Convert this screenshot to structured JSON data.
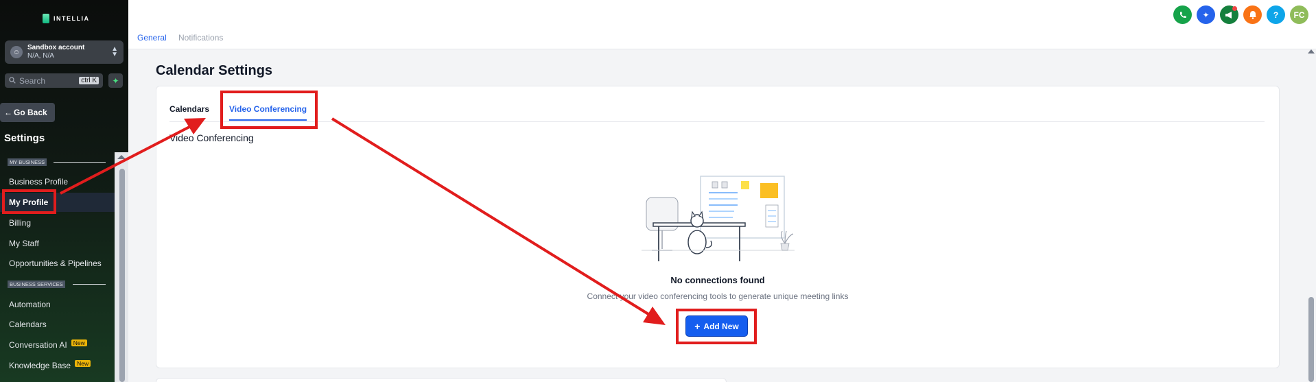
{
  "sidebar": {
    "logo_text": "INTELLIA",
    "account": {
      "name": "Sandbox account",
      "sub": "N/A, N/A"
    },
    "search": {
      "placeholder": "Search",
      "shortcut": "ctrl K"
    },
    "go_back": "Go Back",
    "settings_title": "Settings",
    "sections": [
      {
        "label": "MY BUSINESS"
      },
      {
        "label": "BUSINESS SERVICES"
      }
    ],
    "items": [
      {
        "label": "Business Profile"
      },
      {
        "label": "My Profile",
        "active": true
      },
      {
        "label": "Billing"
      },
      {
        "label": "My Staff"
      },
      {
        "label": "Opportunities & Pipelines"
      },
      {
        "label": "Automation"
      },
      {
        "label": "Calendars"
      },
      {
        "label": "Conversation AI",
        "badge": "New"
      },
      {
        "label": "Knowledge Base",
        "badge": "New"
      }
    ]
  },
  "topbar": {
    "tabs": [
      {
        "label": "General"
      },
      {
        "label": "Notifications"
      }
    ],
    "avatar_initials": "FC",
    "help_glyph": "?",
    "icons": [
      "phone-icon",
      "magic-icon",
      "megaphone-icon",
      "bell-icon",
      "help-icon",
      "user-avatar"
    ],
    "icon_colors": [
      "#16a34a",
      "#2563eb",
      "#15803d",
      "#f97316",
      "#0ea5e9",
      "#84cc16"
    ]
  },
  "page": {
    "title": "Calendar Settings",
    "tabs": [
      {
        "label": "Calendars"
      },
      {
        "label": "Video Conferencing",
        "active": true
      }
    ],
    "section_heading": "Video Conferencing",
    "empty_state": {
      "title": "No connections found",
      "subtitle": "Connect your video conferencing tools to generate unique meeting links",
      "button_label": "Add New"
    }
  },
  "colors": {
    "accent": "#155eef",
    "annotation": "#e11d1d"
  }
}
